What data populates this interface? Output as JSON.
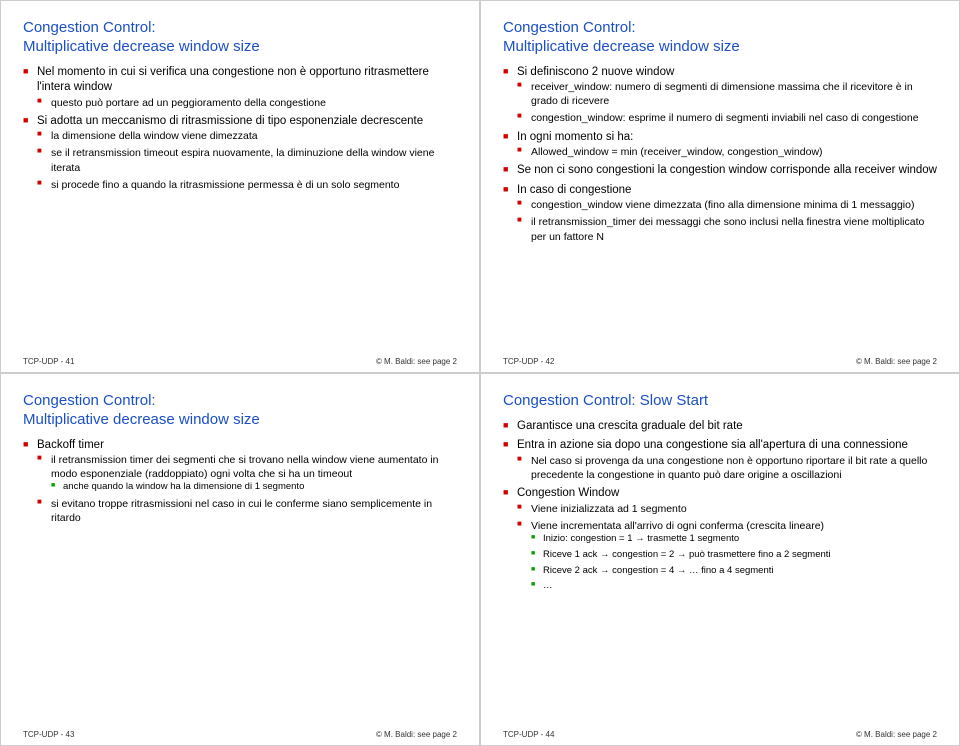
{
  "slides": [
    {
      "title": "Congestion Control:\nMultiplicative decrease window size",
      "footer_left": "TCP-UDP - 41",
      "footer_right": "© M. Baldi: see page 2",
      "items": [
        {
          "text": "Nel momento in cui si verifica una congestione non è opportuno ritrasmettere l'intera window",
          "children": [
            {
              "text": "questo può portare ad un peggioramento della congestione"
            }
          ]
        },
        {
          "text": "Si adotta un meccanismo di ritrasmissione di tipo esponenziale decrescente",
          "children": [
            {
              "text": "la dimensione della window viene dimezzata"
            },
            {
              "text": "se il retransmission timeout espira nuovamente, la diminuzione della window viene iterata"
            },
            {
              "text": "si procede fino a quando la ritrasmissione permessa è di un solo segmento"
            }
          ]
        }
      ]
    },
    {
      "title": "Congestion Control:\nMultiplicative decrease window size",
      "footer_left": "TCP-UDP - 42",
      "footer_right": "© M. Baldi: see page 2",
      "items": [
        {
          "text": "Si definiscono 2 nuove window",
          "children": [
            {
              "text": "receiver_window: numero di segmenti di dimensione massima che il ricevitore è in grado di ricevere"
            },
            {
              "text": "congestion_window: esprime il numero di segmenti inviabili nel caso di congestione"
            }
          ]
        },
        {
          "text": "In ogni momento si ha:",
          "children": [
            {
              "text": "Allowed_window = min (receiver_window, congestion_window)"
            }
          ]
        },
        {
          "text": "Se non ci sono congestioni la congestion window corrisponde alla receiver window"
        },
        {
          "text": "In caso di congestione",
          "children": [
            {
              "text": "congestion_window viene dimezzata (fino alla dimensione minima di 1 messaggio)"
            },
            {
              "text": "il retransmission_timer dei messaggi che sono inclusi nella finestra viene moltiplicato per un fattore N"
            }
          ]
        }
      ]
    },
    {
      "title": "Congestion Control:\nMultiplicative decrease window size",
      "footer_left": "TCP-UDP - 43",
      "footer_right": "© M. Baldi: see page 2",
      "items": [
        {
          "text": "Backoff timer",
          "children": [
            {
              "text": "il retransmission timer dei segmenti che si trovano nella window viene aumentato in modo esponenziale (raddoppiato) ogni volta che si ha un timeout",
              "children": [
                {
                  "text": "anche quando la window ha la dimensione di 1 segmento"
                }
              ]
            },
            {
              "text": "si evitano troppe ritrasmissioni nel caso in cui le conferme siano semplicemente in ritardo"
            }
          ]
        }
      ]
    },
    {
      "title": "Congestion Control: Slow Start",
      "footer_left": "TCP-UDP - 44",
      "footer_right": "© M. Baldi: see page 2",
      "items": [
        {
          "text": "Garantisce una crescita graduale del bit rate"
        },
        {
          "text": "Entra in azione sia dopo una congestione sia all'apertura di una connessione",
          "children": [
            {
              "text": "Nel caso si provenga da una congestione non è opportuno riportare il bit rate a quello precedente la congestione in quanto può dare origine a oscillazioni"
            }
          ]
        },
        {
          "text": "Congestion Window",
          "children": [
            {
              "text": "Viene inizializzata ad 1 segmento"
            },
            {
              "text": "Viene incrementata all'arrivo di ogni conferma (crescita lineare)",
              "children": [
                {
                  "text": "Inizio: congestion = 1 → trasmette 1 segmento"
                },
                {
                  "text": "Riceve 1 ack → congestion = 2 → può trasmettere fino a 2 segmenti"
                },
                {
                  "text": "Riceve 2 ack → congestion = 4 → … fino a 4 segmenti"
                },
                {
                  "text": "…"
                }
              ]
            }
          ]
        }
      ]
    }
  ]
}
